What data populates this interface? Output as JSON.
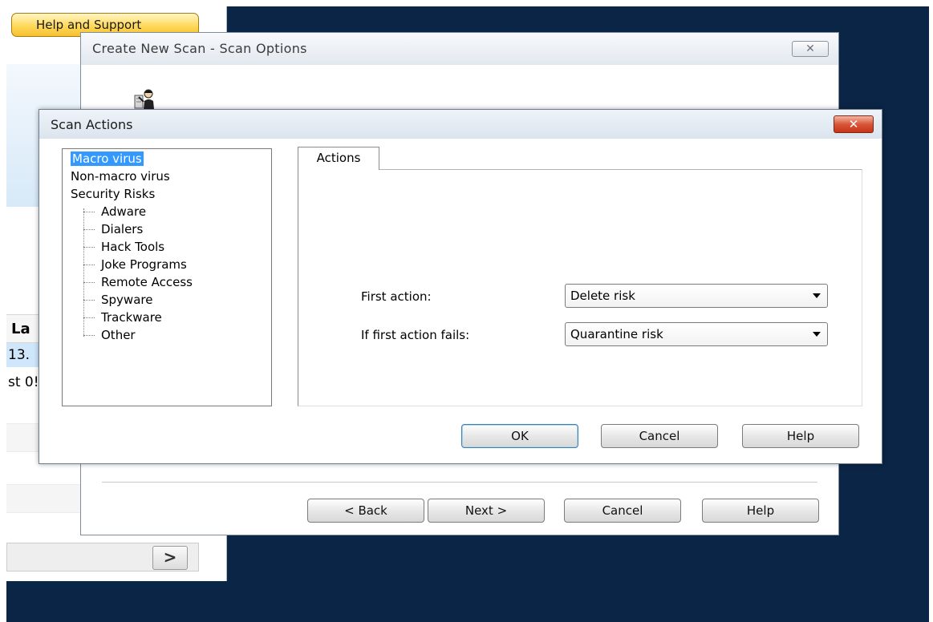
{
  "background_app": {
    "help_support_label": "Help and Support",
    "column_header": "La",
    "row_selected": "13.",
    "row_text": "st 0!",
    "scroll_right_glyph": ">"
  },
  "scan_options_window": {
    "title": "Create New Scan - Scan Options",
    "close_glyph": "✕",
    "buttons": {
      "back": "< Back",
      "next": "Next >",
      "cancel": "Cancel",
      "help": "Help"
    }
  },
  "scan_actions_dialog": {
    "title": "Scan Actions",
    "close_glyph": "✕",
    "tree": {
      "top_items": [
        "Macro virus",
        "Non-macro virus",
        "Security Risks"
      ],
      "children": [
        "Adware",
        "Dialers",
        "Hack Tools",
        "Joke Programs",
        "Remote Access",
        "Spyware",
        "Trackware",
        "Other"
      ],
      "selected": "Macro virus"
    },
    "tab_label": "Actions",
    "first_action": {
      "label": "First action:",
      "value": "Delete risk"
    },
    "if_fails": {
      "label": "If first action fails:",
      "value": "Quarantine risk"
    },
    "buttons": {
      "ok": "OK",
      "cancel": "Cancel",
      "help": "Help"
    }
  },
  "colors": {
    "desktop": "#0b2546",
    "selection": "#3399ff",
    "close_red": "#c7341a",
    "help_button_gold": "#ffd95a"
  },
  "icons": {
    "scan_options_window": "wizard-person-icon"
  }
}
